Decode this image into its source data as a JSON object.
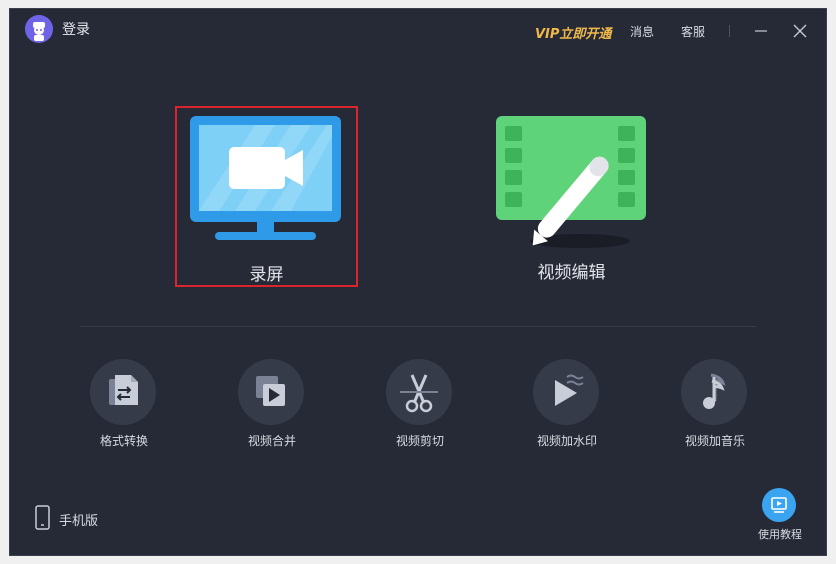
{
  "header": {
    "login_label": "登录",
    "vip_label": "VIP立即开通",
    "messages_label": "消息",
    "service_label": "客服"
  },
  "main_tiles": [
    {
      "label": "录屏",
      "icon": "monitor-camera-icon"
    },
    {
      "label": "视频编辑",
      "icon": "film-pen-icon"
    }
  ],
  "tools": [
    {
      "label": "格式转换",
      "icon": "format-convert-icon"
    },
    {
      "label": "视频合并",
      "icon": "video-merge-icon"
    },
    {
      "label": "视频剪切",
      "icon": "scissors-icon"
    },
    {
      "label": "视频加水印",
      "icon": "watermark-icon"
    },
    {
      "label": "视频加音乐",
      "icon": "music-note-icon"
    }
  ],
  "footer": {
    "mobile_label": "手机版",
    "tutorial_label": "使用教程"
  },
  "colors": {
    "background": "#262a36",
    "accent_blue": "#2f9ae8",
    "accent_green": "#5fd37a",
    "vip_gold": "#f0b94a",
    "selection_red": "#d9252b"
  }
}
